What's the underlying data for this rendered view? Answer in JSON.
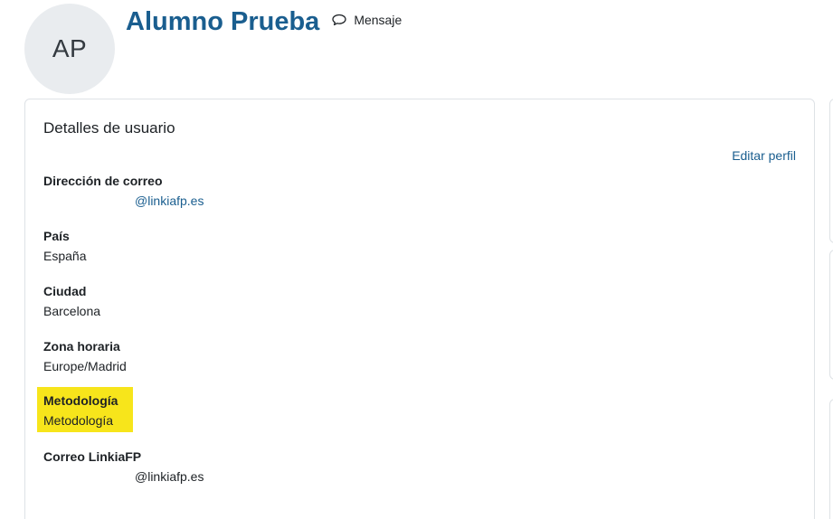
{
  "profile": {
    "initials": "AP",
    "fullname": "Alumno Prueba",
    "message_label": "Mensaje"
  },
  "details": {
    "title": "Detalles de usuario",
    "edit_label": "Editar perfil",
    "fields": [
      {
        "label": "Dirección de correo",
        "value": "@linkiafp.es"
      },
      {
        "label": "País",
        "value": "España"
      },
      {
        "label": "Ciudad",
        "value": "Barcelona"
      },
      {
        "label": "Zona horaria",
        "value": "Europe/Madrid"
      },
      {
        "label": "Metodología",
        "value": "Metodología"
      },
      {
        "label": "Correo LinkiaFP",
        "value": "@linkiafp.es"
      }
    ]
  },
  "colors": {
    "highlight": "#f7e51b",
    "name": "#1a5e8f",
    "link": "#1a5e8f"
  },
  "icons": {
    "message": "speech-bubble-icon"
  }
}
